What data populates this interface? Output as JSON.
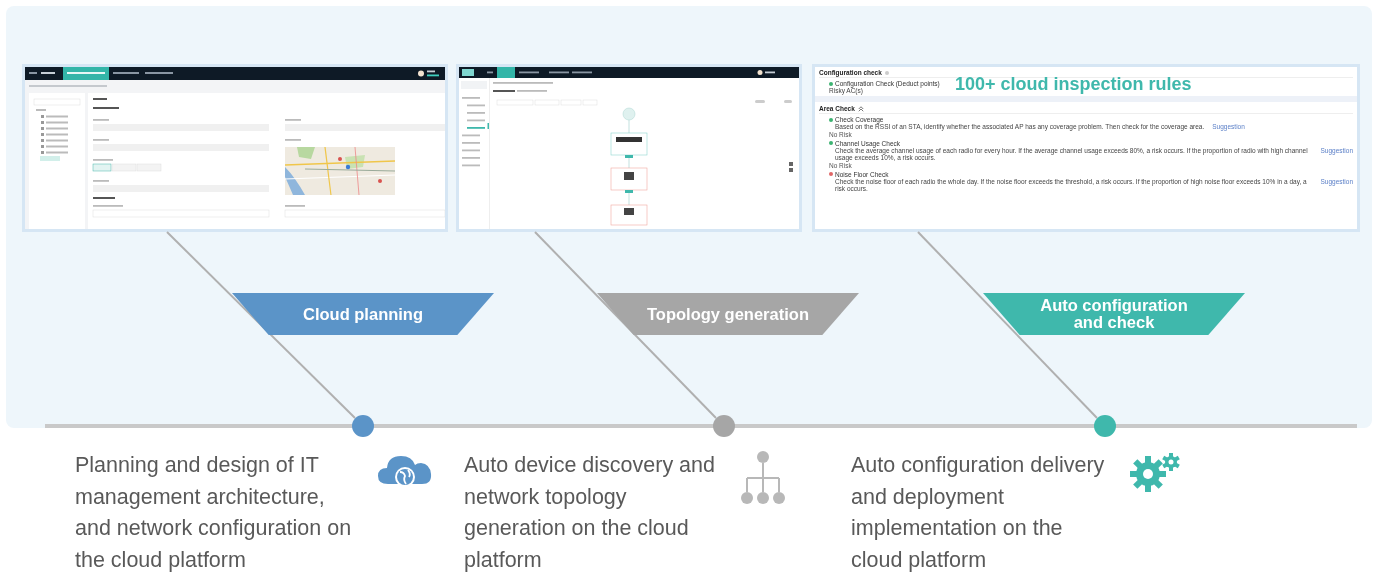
{
  "stages": [
    {
      "kind": "planning",
      "banner": {
        "label": "Cloud planning",
        "color": "#5b94c8"
      },
      "description": "Planning and design of IT management architecture, and network configuration on the cloud platform"
    },
    {
      "kind": "topology",
      "banner": {
        "label": "Topology generation",
        "color": "#a6a6a6"
      },
      "description": "Auto device discovery and network topology generation on the cloud platform"
    },
    {
      "kind": "check",
      "banner": {
        "label": "Auto configuration and check",
        "color": "#3fb8ac"
      },
      "description": "Auto configuration delivery and deployment implementation on the cloud platform",
      "screenshot": {
        "headline": "100+ cloud inspection rules",
        "config_title": "Configuration check",
        "config_item": {
          "title": "Configuration Check (Deduct points)",
          "color": "#3cb371"
        },
        "config_note": "Risky AC(s)",
        "area_title": "Area Check",
        "checks": [
          {
            "title": "Check Coverage",
            "color": "#3cb371",
            "description": "Based on the RSSI of an STA, identify whether the associated AP has any coverage problem. Then check for the coverage area.",
            "link": "Suggestion",
            "risk": "No Risk"
          },
          {
            "title": "Channel Usage Check",
            "color": "#3cb371",
            "description": "Check the average channel usage of each radio for every hour. If the average channel usage exceeds 80%, a risk occurs. If the proportion of radio with high channel usage exceeds 10%, a risk occurs.",
            "link": "Suggestion",
            "risk": "No Risk"
          },
          {
            "title": "Noise Floor Check",
            "color": "#e06666",
            "description": "Check the noise floor of each radio the whole day. If the noise floor exceeds the threshold, a risk occurs. If the proportion of high noise floor exceeds 10% in a day, a risk occurs.",
            "link": "Suggestion"
          }
        ]
      }
    }
  ]
}
